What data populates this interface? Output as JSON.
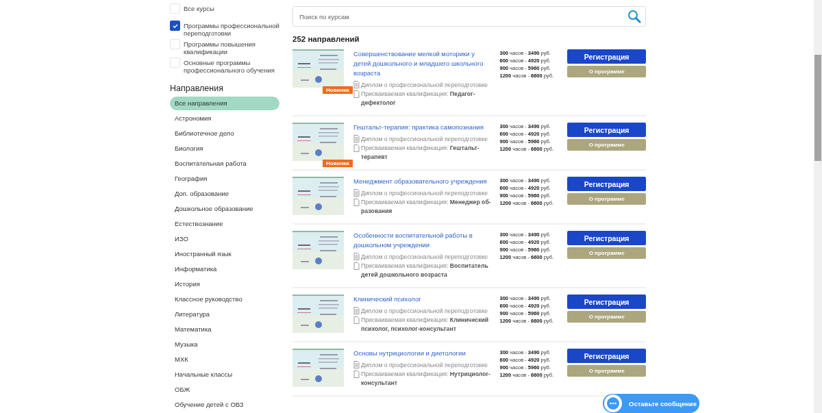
{
  "filters": [
    {
      "label": "Все курсы",
      "checked": false
    },
    {
      "label": "Программы профессиональной переподготовки",
      "checked": true
    },
    {
      "label": "Программы повышения квалификации",
      "checked": false
    },
    {
      "label": "Основные программы профессионального обучения",
      "checked": false
    }
  ],
  "directions": {
    "title": "Направления",
    "items": [
      {
        "label": "Все направления",
        "selected": true
      },
      {
        "label": "Астрономия",
        "selected": false
      },
      {
        "label": "Библиотечное дело",
        "selected": false
      },
      {
        "label": "Биология",
        "selected": false
      },
      {
        "label": "Воспитательная работа",
        "selected": false
      },
      {
        "label": "География",
        "selected": false
      },
      {
        "label": "Доп. образование",
        "selected": false
      },
      {
        "label": "Дошкольное образование",
        "selected": false
      },
      {
        "label": "Естествознание",
        "selected": false
      },
      {
        "label": "ИЗО",
        "selected": false
      },
      {
        "label": "Иностранный язык",
        "selected": false
      },
      {
        "label": "Информатика",
        "selected": false
      },
      {
        "label": "История",
        "selected": false
      },
      {
        "label": "Классное руководство",
        "selected": false
      },
      {
        "label": "Литература",
        "selected": false
      },
      {
        "label": "Математика",
        "selected": false
      },
      {
        "label": "Музыка",
        "selected": false
      },
      {
        "label": "МХК",
        "selected": false
      },
      {
        "label": "Начальные классы",
        "selected": false
      },
      {
        "label": "ОБЖ",
        "selected": false
      },
      {
        "label": "Обучение детей с ОВЗ",
        "selected": false
      }
    ]
  },
  "search": {
    "placeholder": "Поиск по курсам"
  },
  "count": "252 направлений",
  "courses": [
    {
      "title": "Совершенствование мелкой моторики у детей дошкольного и младшего школьного возраста",
      "badge": "Новинка",
      "diploma": "Диплом о профессиональной переподготовке",
      "qualification": "Присваиваемая квалификация: **Педагог-дефектолог**",
      "prices": [
        "**300** часов - **3490** руб.",
        "**600** часов - **4920** руб.",
        "**900** часов - **5960** руб.",
        "**1200** часов - **6600** руб."
      ],
      "register": "Регистрация",
      "about": "О программе"
    },
    {
      "title": "Гештальт-терапия: практика самопознания",
      "badge": "Новинка",
      "diploma": "Диплом о профессиональной переподготовке",
      "qualification": "Присваиваемая квалификация: **Гештальт-терапевт**",
      "prices": [
        "**300** часов - **3490** руб.",
        "**600** часов - **4920** руб.",
        "**900** часов - **5960** руб.",
        "**1200** часов - **6600** руб."
      ],
      "register": "Регистрация",
      "about": "О программе"
    },
    {
      "title": "Менеджмент образовательного учреждения",
      "diploma": "Диплом о профессиональной переподготовке",
      "qualification": "Присваиваемая квалификация: **Менеджер об-разования**",
      "prices": [
        "**300** часов - **3490** руб.",
        "**600** часов - **4920** руб.",
        "**900** часов - **5960** руб.",
        "**1200** часов - **6600** руб."
      ],
      "register": "Регистрация",
      "about": "О программе"
    },
    {
      "title": "Особенности воспитательной работы в дошкольном учреждении",
      "diploma": "Диплом о профессиональной переподготовке",
      "qualification": "Присваиваемая квалификация: **Воспитатель детей дошкольного возраста**",
      "prices": [
        "**300** часов - **3490** руб.",
        "**600** часов - **4920** руб.",
        "**900** часов - **5960** руб.",
        "**1200** часов - **6600** руб."
      ],
      "register": "Регистрация",
      "about": "О программе"
    },
    {
      "title": "Клинический психолог",
      "diploma": "Диплом о профессиональной переподготовке",
      "qualification": "Присваиваемая квалификация: **Клинический психолог, психолог-консультант**",
      "prices": [
        "**300** часов - **3490** руб.",
        "**600** часов - **4920** руб.",
        "**900** часов - **5960** руб.",
        "**1200** часов - **6600** руб."
      ],
      "register": "Регистрация",
      "about": "О программе"
    },
    {
      "title": "Основы нутрициологии и диетологии",
      "diploma": "Диплом о профессиональной переподготовке",
      "qualification": "Присваиваемая квалификация: **Нутрициолог-консультант**",
      "prices": [
        "**300** часов - **3490** руб.",
        "**600** часов - **4920** руб.",
        "**900** часов - **5960** руб.",
        "**1200** часов - **6600** руб."
      ],
      "register": "Регистрация",
      "about": "О программе"
    }
  ],
  "chat": {
    "label": "Оставьте сообщение"
  }
}
